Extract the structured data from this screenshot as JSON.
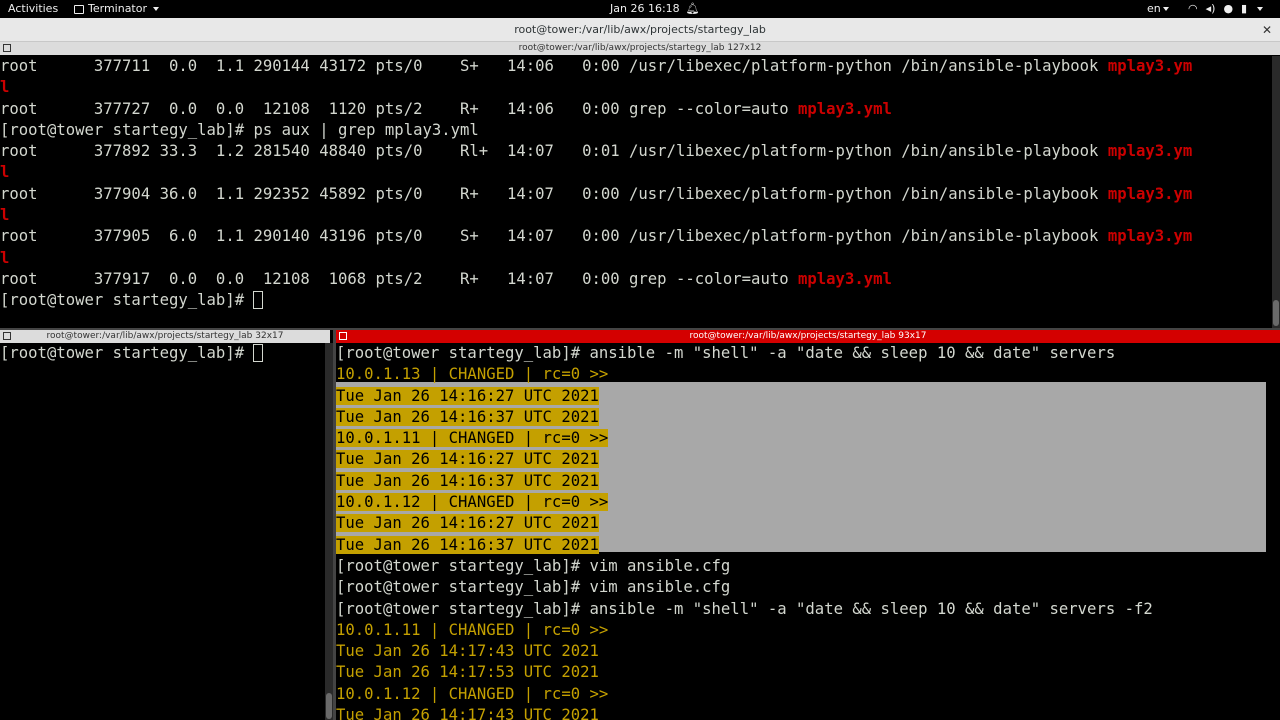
{
  "topbar": {
    "activities": "Activities",
    "app_name": "Terminator",
    "clock": "Jan 26  16:18",
    "lang": "en"
  },
  "window": {
    "title": "root@tower:/var/lib/awx/projects/startegy_lab"
  },
  "top_pane": {
    "title": "root@tower:/var/lib/awx/projects/startegy_lab 127x12",
    "lines": [
      [
        {
          "t": "root      377711  0.0  1.1 290144 43172 pts/0    S+   14:06   0:00 /usr/libexec/platform-python /bin/ansible-playbook "
        },
        {
          "t": "mplay3.ym",
          "c": "red"
        }
      ],
      [
        {
          "t": "l",
          "c": "red"
        }
      ],
      [
        {
          "t": "root      377727  0.0  0.0  12108  1120 pts/2    R+   14:06   0:00 grep --color=auto "
        },
        {
          "t": "mplay3.yml",
          "c": "red"
        }
      ],
      [
        {
          "t": "[root@tower startegy_lab]# ps aux | grep mplay3.yml"
        }
      ],
      [
        {
          "t": "root      377892 33.3  1.2 281540 48840 pts/0    Rl+  14:07   0:01 /usr/libexec/platform-python /bin/ansible-playbook "
        },
        {
          "t": "mplay3.ym",
          "c": "red"
        }
      ],
      [
        {
          "t": "l",
          "c": "red"
        }
      ],
      [
        {
          "t": "root      377904 36.0  1.1 292352 45892 pts/0    R+   14:07   0:00 /usr/libexec/platform-python /bin/ansible-playbook "
        },
        {
          "t": "mplay3.ym",
          "c": "red"
        }
      ],
      [
        {
          "t": "l",
          "c": "red"
        }
      ],
      [
        {
          "t": "root      377905  6.0  1.1 290140 43196 pts/0    S+   14:07   0:00 /usr/libexec/platform-python /bin/ansible-playbook "
        },
        {
          "t": "mplay3.ym",
          "c": "red"
        }
      ],
      [
        {
          "t": "l",
          "c": "red"
        }
      ],
      [
        {
          "t": "root      377917  0.0  0.0  12108  1068 pts/2    R+   14:07   0:00 grep --color=auto "
        },
        {
          "t": "mplay3.yml",
          "c": "red"
        }
      ],
      [
        {
          "t": "[root@tower startegy_lab]# "
        },
        {
          "cursor": true
        }
      ]
    ]
  },
  "left_pane": {
    "title": "root@tower:/var/lib/awx/projects/startegy_lab 32x17",
    "lines": [
      [
        {
          "t": "[root@tower startegy_lab]# "
        },
        {
          "cursor": true
        }
      ]
    ]
  },
  "right_pane": {
    "title": "root@tower:/var/lib/awx/projects/startegy_lab 93x17",
    "lines": [
      [
        {
          "t": "[root@tower startegy_lab]# ansible -m \"shell\" -a \"date && sleep 10 && date\" servers"
        }
      ],
      [
        {
          "t": "10.0.1.13 | CHANGED | rc=0 >>",
          "c": "yel"
        }
      ],
      [
        {
          "t": "Tue Jan 26 14:16:27 UTC 2021",
          "c": "hl"
        }
      ],
      [
        {
          "t": "Tue Jan 26 14:16:37 UTC 2021",
          "c": "hl"
        }
      ],
      [
        {
          "t": "10.0.1.11 | CHANGED | rc=0 >>",
          "c": "hl"
        }
      ],
      [
        {
          "t": "Tue Jan 26 14:16:27 UTC 2021",
          "c": "hl"
        }
      ],
      [
        {
          "t": "Tue Jan 26 14:16:37 UTC 2021",
          "c": "hl"
        }
      ],
      [
        {
          "t": "10.0.1.12 | CHANGED | rc=0 >>",
          "c": "hl"
        }
      ],
      [
        {
          "t": "Tue Jan 26 14:16:27 UTC 2021",
          "c": "hl"
        }
      ],
      [
        {
          "t": "Tue Jan 26 14:16:37 UTC 2021",
          "c": "hl"
        }
      ],
      [
        {
          "t": "[root@tower startegy_lab]# vim ansible.cfg"
        }
      ],
      [
        {
          "t": "[root@tower startegy_lab]# vim ansible.cfg"
        }
      ],
      [
        {
          "t": "[root@tower startegy_lab]# ansible -m \"shell\" -a \"date && sleep 10 && date\" servers -f2"
        }
      ],
      [
        {
          "t": "10.0.1.11 | CHANGED | rc=0 >>",
          "c": "yel"
        }
      ],
      [
        {
          "t": "Tue Jan 26 14:17:43 UTC 2021",
          "c": "yel"
        }
      ],
      [
        {
          "t": "Tue Jan 26 14:17:53 UTC 2021",
          "c": "yel"
        }
      ],
      [
        {
          "t": "10.0.1.12 | CHANGED | rc=0 >>",
          "c": "yel"
        }
      ],
      [
        {
          "t": "Tue Jan 26 14:17:43 UTC 2021",
          "c": "yel"
        }
      ]
    ]
  }
}
